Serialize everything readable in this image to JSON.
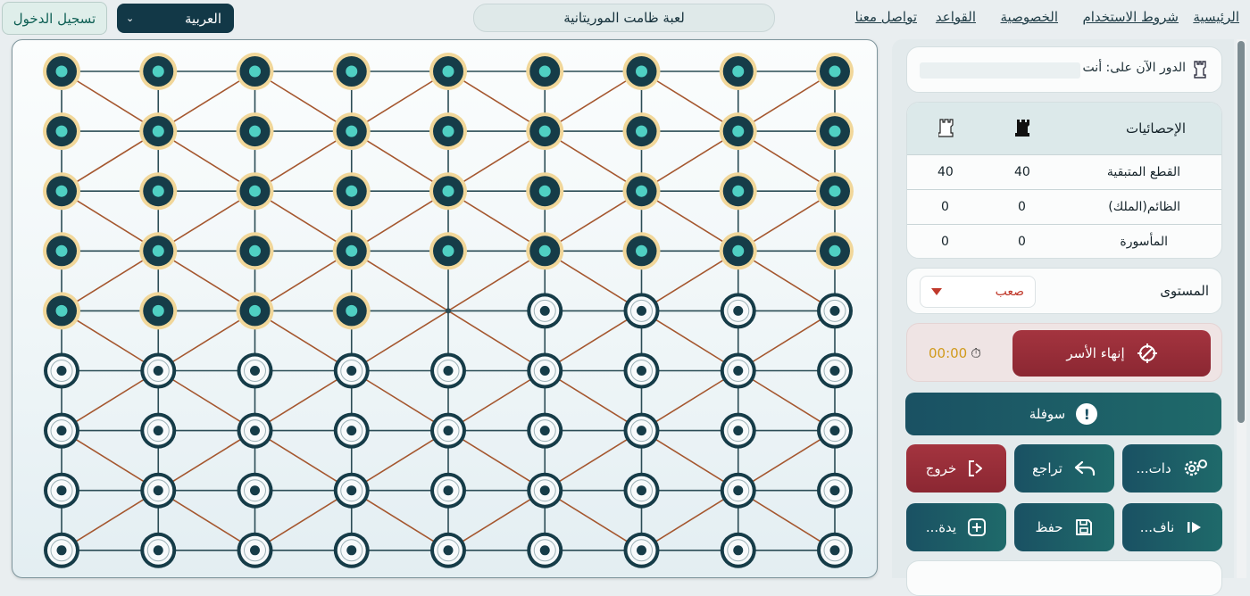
{
  "nav": {
    "home": "الرئيسية",
    "terms": "شروط الاستخدام",
    "privacy": "الخصوصية",
    "rules": "القواعد",
    "contact": "تواصل معنا"
  },
  "game_title": "لعبة ظامت الموريتانية",
  "language": {
    "selected": "العربية"
  },
  "login_label": "تسجيل الدخول",
  "turn": {
    "text": "الدور الآن على: أنت"
  },
  "stats": {
    "header": "الإحصائيات",
    "black_piece_icon": "rook-black-icon",
    "white_piece_icon": "rook-white-icon",
    "rows": [
      {
        "label": "القطع المتبقية",
        "black": "40",
        "white": "40"
      },
      {
        "label": "الظائم(الملك)",
        "black": "0",
        "white": "0"
      },
      {
        "label": "المأسورة",
        "black": "0",
        "white": "0"
      }
    ]
  },
  "level": {
    "label": "المستوى",
    "value": "صعب"
  },
  "end_capture_label": "إنهاء الأسر",
  "timer": "00:00",
  "sofla_label": "سوفلة",
  "buttons": {
    "settings": "...دات",
    "undo": "تراجع",
    "exit": "خروج",
    "resume": "...ناف",
    "save": "حفظ",
    "new": "...يدة"
  },
  "colors": {
    "dark_piece_fill": "#163c48",
    "dark_piece_core": "#4fd0c3",
    "dark_piece_ring": "#f1d79a",
    "light_piece_fill": "#f7fafb",
    "light_piece_core": "#163c48",
    "straight_line": "#2b4c55",
    "diagonal_line": "#a5572f",
    "accent_red": "#8b2732",
    "accent_teal": "#1a5163"
  },
  "board": {
    "cols": 9,
    "rows": 9,
    "layout": [
      "DDDDDDDDD",
      "DDDDDDDDD",
      "DDDDDDDDD",
      "DDDDDDDDD",
      "DDDD.LLLL",
      "LLLLLLLLL",
      "LLLLLLLLL",
      "LLLLLLLLL",
      "LLLLLLLLL"
    ]
  }
}
